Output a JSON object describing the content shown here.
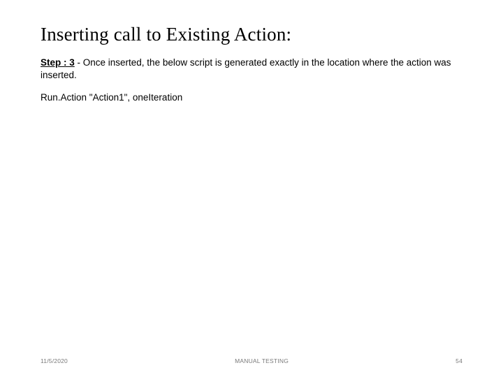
{
  "title": "Inserting call to Existing Action:",
  "step": {
    "label": "Step : 3",
    "desc": " - Once inserted, the below script is generated exactly in the location where the action was inserted."
  },
  "code": "Run.Action \"Action1\", oneIteration",
  "footer": {
    "date": "11/5/2020",
    "center": "MANUAL TESTING",
    "page": "54"
  }
}
